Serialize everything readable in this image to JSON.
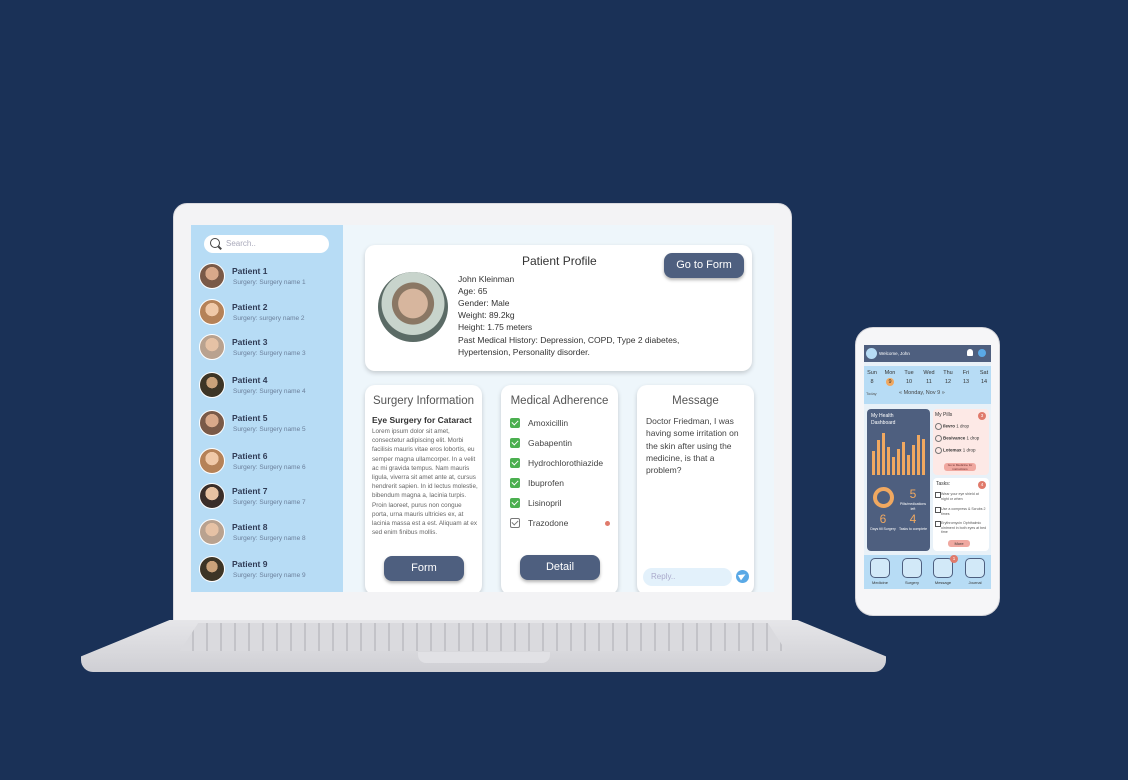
{
  "laptop": {
    "search": {
      "placeholder": "Search.."
    },
    "patients": [
      {
        "name": "Patient 1",
        "surgery": "Surgery: Surgery name 1"
      },
      {
        "name": "Patient 2",
        "surgery": "Surgery: surgery name 2"
      },
      {
        "name": "Patient 3",
        "surgery": "Surgery: Surgery name 3"
      },
      {
        "name": "Patient 4",
        "surgery": "Surgery: Surgery name 4"
      },
      {
        "name": "Patient 5",
        "surgery": "Surgery: Surgery name 5"
      },
      {
        "name": "Patient 6",
        "surgery": "Surgery: Surgery name 6"
      },
      {
        "name": "Patient 7",
        "surgery": "Surgery: Surgery name 7"
      },
      {
        "name": "Patient 8",
        "surgery": "Surgery: Surgery name 8"
      },
      {
        "name": "Patient 9",
        "surgery": "Surgery: Surgery name 9"
      }
    ],
    "profile": {
      "title": "Patient Profile",
      "name": "John Kleinman",
      "age": "Age: 65",
      "gender": "Gender: Male",
      "weight": "Weight: 89.2kg",
      "height": "Height: 1.75 meters",
      "history": "Past Medical History: Depression, COPD, Type 2 diabetes, Hypertension, Personality disorder.",
      "go_to_form": "Go to Form"
    },
    "surgery": {
      "title": "Surgery Information",
      "subtitle": "Eye Surgery for Cataract",
      "body": "Lorem ipsum dolor sit amet, consectetur adipiscing elit. Morbi facilisis mauris vitae eros lobortis, eu semper magna ullamcorper. In a velit ac mi gravida tempus. Nam mauris ligula, viverra sit amet ante at, cursus hendrerit sapien. In id lectus molestie, bibendum magna a, lacinia turpis. Proin laoreet, purus non congue porta, urna mauris ultricies ex, at lacinia massa est a est. Aliquam at ex sed enim finibus mollis.",
      "button": "Form"
    },
    "adherence": {
      "title": "Medical Adherence",
      "meds": [
        {
          "name": "Amoxicillin",
          "checked": true
        },
        {
          "name": "Gabapentin",
          "checked": true
        },
        {
          "name": "Hydrochlorothiazide",
          "checked": true
        },
        {
          "name": "Ibuprofen",
          "checked": true
        },
        {
          "name": "Lisinopril",
          "checked": true
        },
        {
          "name": "Trazodone",
          "checked": false
        }
      ],
      "button": "Detail"
    },
    "message": {
      "title": "Message",
      "text": "Doctor Friedman, I was having some irritation on the skin after using the medicine, is that a problem?",
      "reply_placeholder": "Reply.."
    }
  },
  "phone": {
    "welcome": "Welcome, John",
    "calendar": {
      "days": [
        {
          "day": "Sun",
          "num": "8"
        },
        {
          "day": "Mon",
          "num": "9"
        },
        {
          "day": "Tue",
          "num": "10"
        },
        {
          "day": "Wed",
          "num": "11"
        },
        {
          "day": "Thu",
          "num": "12"
        },
        {
          "day": "Fri",
          "num": "13"
        },
        {
          "day": "Sat",
          "num": "14"
        }
      ],
      "today": "Today",
      "date": "Monday, Nov 9"
    },
    "dashboard": {
      "title": "My Health Dashboard",
      "stats": [
        {
          "num": "5",
          "label": "Pills/medications left"
        },
        {
          "num": "6",
          "label": "Days till Surgery"
        },
        {
          "num": "4",
          "label": "Tasks to complete"
        }
      ]
    },
    "pills": {
      "title": "My Pills",
      "count": "3",
      "items": [
        {
          "name": "Ilevro",
          "dose": "1 drop"
        },
        {
          "name": "Besivance",
          "dose": "1 drop"
        },
        {
          "name": "Lotemax",
          "dose": "1 drop"
        }
      ],
      "button": "Go to Medicine for instructions"
    },
    "tasks": {
      "title": "Tasks:",
      "count": "4",
      "items": [
        "Wear your eye shield at night or when",
        "Use a compress & Scrubs 2 times",
        "Erythromycin Ophthalmic ointment in both eyes at bed time"
      ],
      "button": "More"
    },
    "nav": [
      {
        "label": "Medicine"
      },
      {
        "label": "Surgery"
      },
      {
        "label": "Message",
        "badge": "1"
      },
      {
        "label": "Journal"
      }
    ]
  }
}
